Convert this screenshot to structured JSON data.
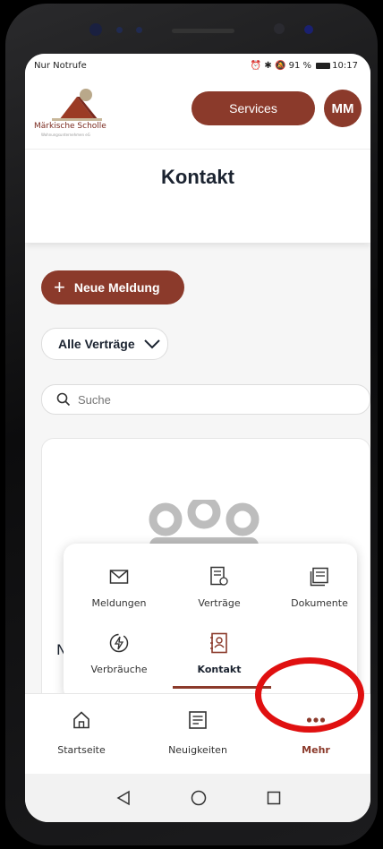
{
  "statusbar": {
    "left": "Nur Notrufe",
    "battery": "91 %",
    "time": "10:17"
  },
  "header": {
    "logo_name": "Märkische Scholle",
    "logo_sub": "Wohnungsunternehmen eG",
    "services_label": "Services",
    "avatar_initials": "MM"
  },
  "page": {
    "title": "Kontakt"
  },
  "actions": {
    "new_report_label": "Neue Meldung",
    "contract_filter_label": "Alle Verträge"
  },
  "search": {
    "placeholder": "Suche",
    "value": ""
  },
  "card": {
    "text": "N"
  },
  "popup": {
    "items": [
      {
        "label": "Meldungen",
        "icon": "mail-icon"
      },
      {
        "label": "Verträge",
        "icon": "contract-icon"
      },
      {
        "label": "Dokumente",
        "icon": "documents-icon"
      },
      {
        "label": "Verbräuche",
        "icon": "consumption-icon"
      },
      {
        "label": "Kontakt",
        "icon": "contact-book-icon",
        "active": true
      }
    ]
  },
  "bottom_nav": {
    "items": [
      {
        "label": "Startseite",
        "icon": "home-icon"
      },
      {
        "label": "Neuigkeiten",
        "icon": "news-icon"
      },
      {
        "label": "Mehr",
        "icon": "more-icon",
        "active": true
      }
    ]
  },
  "colors": {
    "accent": "#8b3a2b",
    "highlight": "#e01010",
    "title": "#1b2330"
  }
}
